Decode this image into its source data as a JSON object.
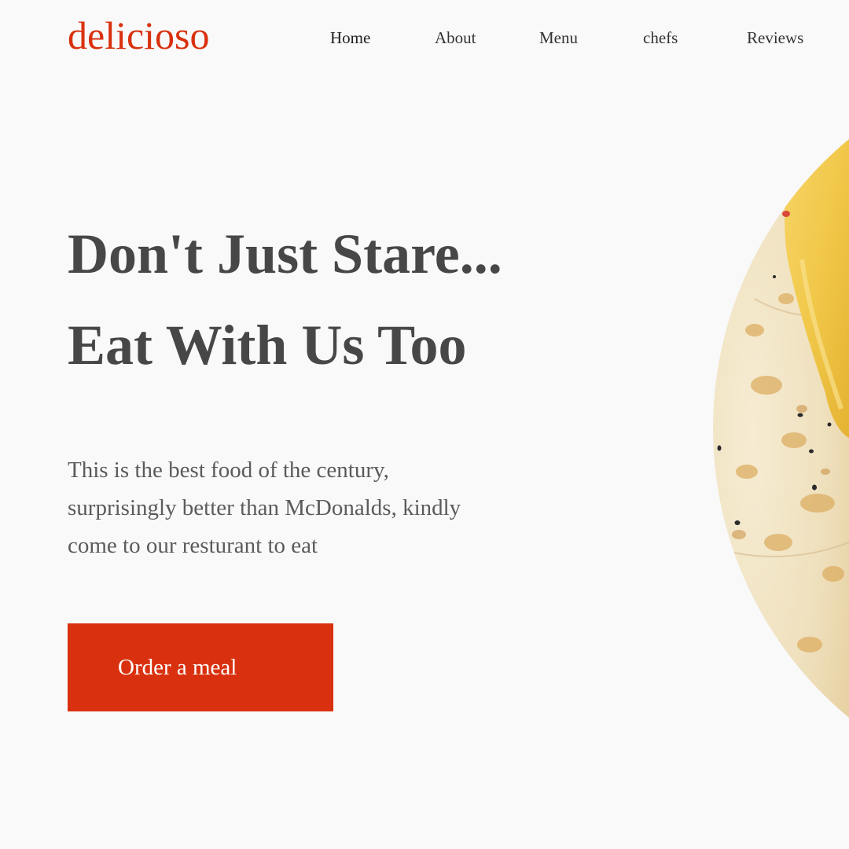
{
  "brand": {
    "logo_text": "delicioso",
    "accent_color": "#d9310f"
  },
  "nav": {
    "items": [
      "Home",
      "About",
      "Menu",
      "chefs",
      "Reviews"
    ]
  },
  "hero": {
    "headline_line1": "Don't Just Stare...",
    "headline_line2": "Eat With Us Too",
    "description_lines": [
      "This is the best food of the century,",
      "surprisingly better than McDonalds, kindly",
      "come to our resturant to eat"
    ],
    "cta_label": "Order a meal"
  },
  "image": {
    "subject": "food-photo-flatbread-with-cheese"
  }
}
